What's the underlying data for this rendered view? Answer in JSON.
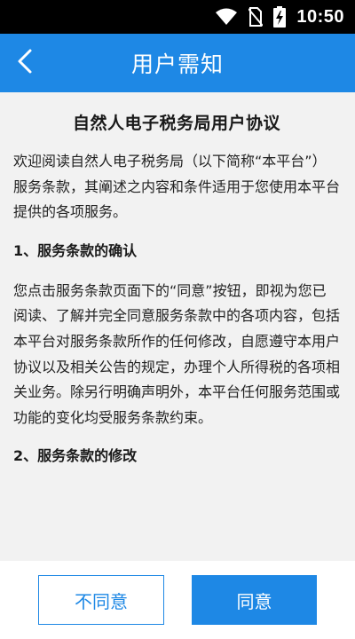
{
  "status_bar": {
    "time": "10:50",
    "icons": [
      "wifi-icon",
      "no-sim-icon",
      "battery-charging-icon"
    ]
  },
  "header": {
    "back_icon": "chevron-left-icon",
    "title": "用户需知"
  },
  "document": {
    "title": "自然人电子税务局用户协议",
    "intro": "欢迎阅读自然人电子税务局（以下简称“本平台”）服务条款，其阐述之内容和条件适用于您使用本平台提供的各项服务。",
    "sections": [
      {
        "heading": "1、服务条款的确认",
        "body": "您点击服务条款页面下的“同意”按钮，即视为您已阅读、了解并完全同意服务条款中的各项内容，包括本平台对服务条款所作的任何修改，自愿遵守本用户协议以及相关公告的规定，办理个人所得税的各项相关业务。除另行明确声明外，本平台任何服务范围或功能的变化均受服务条款约束。"
      },
      {
        "heading": "2、服务条款的修改"
      }
    ]
  },
  "actions": {
    "disagree_label": "不同意",
    "agree_label": "同意"
  },
  "colors": {
    "primary": "#1e88e5",
    "status_bar": "#000000",
    "background": "#f2f2f2"
  }
}
